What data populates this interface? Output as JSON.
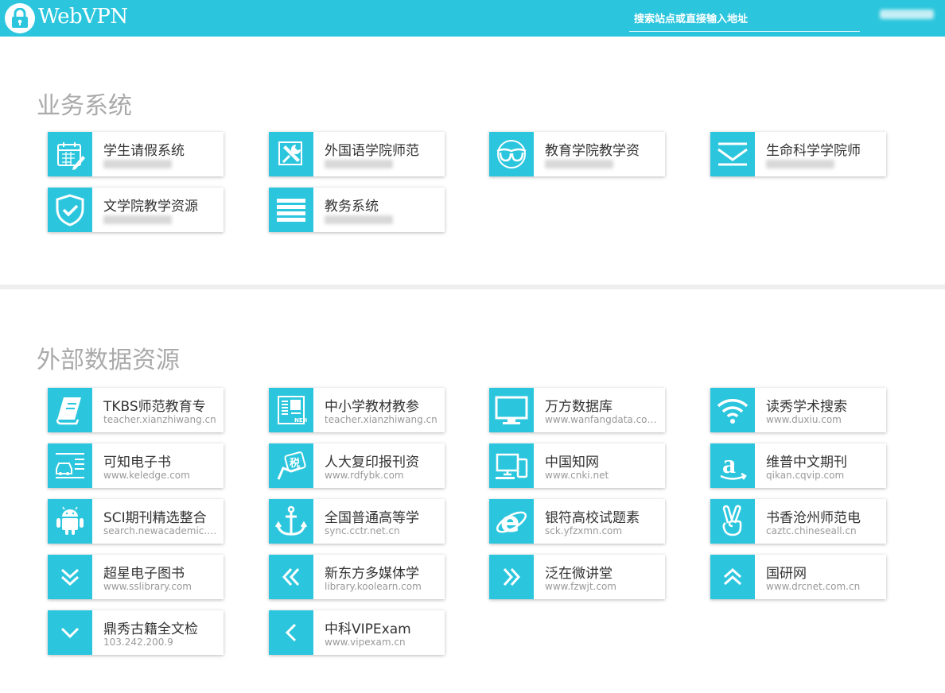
{
  "header": {
    "brand": "WebVPN",
    "search_placeholder": "搜索站点或直接输入地址"
  },
  "sections": [
    {
      "title": "业务系统",
      "items": [
        {
          "name": "学生请假系统",
          "icon": "calendar-edit-icon"
        },
        {
          "name": "外国语学院师范",
          "icon": "tools-icon"
        },
        {
          "name": "教育学院教学资",
          "icon": "glasses-icon"
        },
        {
          "name": "生命科学学院师",
          "icon": "envelope-icon"
        },
        {
          "name": "文学院教学资源",
          "icon": "shield-check-icon"
        },
        {
          "name": "教务系统",
          "icon": "list-lines-icon"
        }
      ]
    },
    {
      "title": "外部数据资源",
      "items": [
        {
          "name": "TKBS师范教育专",
          "url": "teacher.xianzhiwang.cn",
          "icon": "book-icon"
        },
        {
          "name": "中小学教材教参",
          "url": "teacher.xianzhiwang.cn",
          "icon": "newspaper-icon"
        },
        {
          "name": "万方数据库",
          "url": "www.wanfangdata.com...",
          "icon": "monitor-icon"
        },
        {
          "name": "读秀学术搜索",
          "url": "www.duxiu.com",
          "icon": "wifi-icon"
        },
        {
          "name": "可知电子书",
          "url": "www.keledge.com",
          "icon": "car-document-icon"
        },
        {
          "name": "人大复印报刊资",
          "url": "www.rdfybk.com",
          "icon": "tax-hand-icon"
        },
        {
          "name": "中国知网",
          "url": "www.cnki.net",
          "icon": "devices-icon"
        },
        {
          "name": "维普中文期刊",
          "url": "qikan.cqvip.com",
          "icon": "amazon-icon"
        },
        {
          "name": "SCI期刊精选整合",
          "url": "search.newacademic.net",
          "icon": "android-icon"
        },
        {
          "name": "全国普通高等学",
          "url": "sync.cctr.net.cn",
          "icon": "anchor-icon"
        },
        {
          "name": "银符高校试题素",
          "url": "sck.yfzxmn.com",
          "icon": "internet-explorer-icon"
        },
        {
          "name": "书香沧州师范电",
          "url": "caztc.chineseall.cn",
          "icon": "victory-hand-icon"
        },
        {
          "name": "超星电子图书",
          "url": "www.sslibrary.com",
          "icon": "double-chevron-down-icon"
        },
        {
          "name": "新东方多媒体学",
          "url": "library.koolearn.com",
          "icon": "double-chevron-left-icon"
        },
        {
          "name": "泛在微讲堂",
          "url": "www.fzwjt.com",
          "icon": "double-chevron-right-icon"
        },
        {
          "name": "国研网",
          "url": "www.drcnet.com.cn",
          "icon": "double-chevron-up-icon"
        },
        {
          "name": "鼎秀古籍全文检",
          "url": "103.242.200.9",
          "icon": "chevron-down-icon"
        },
        {
          "name": "中科VIPExam",
          "url": "www.vipexam.cn",
          "icon": "chevron-left-icon"
        }
      ]
    }
  ],
  "colors": {
    "accent": "#2bc6dd",
    "title": "#aaaaaa",
    "text": "#333333",
    "url": "#999999"
  }
}
